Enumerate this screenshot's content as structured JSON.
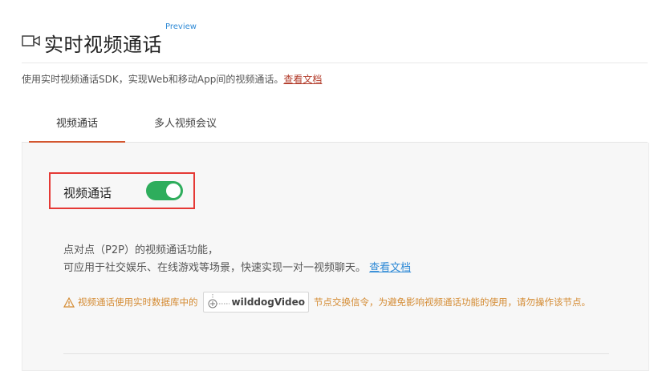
{
  "header": {
    "title": "实时视频通话",
    "badge": "Preview",
    "icon": "video-camera-icon"
  },
  "description": {
    "text": "使用实时视频通话SDK，实现Web和移动App间的视频通话。",
    "link": "查看文档"
  },
  "tabs": [
    {
      "label": "视频通话",
      "active": true
    },
    {
      "label": "多人视频会议",
      "active": false
    }
  ],
  "panel": {
    "toggle": {
      "label": "视频通话",
      "on": true
    },
    "feature_line1": "点对点（P2P）的视频通话功能，",
    "feature_line2": "可应用于社交娱乐、在线游戏等场景，快速实现一对一视频聊天。",
    "feature_link": "查看文档",
    "warning": {
      "before": "视频通话使用实时数据库中的",
      "node": "wilddogVideo",
      "after": "节点交换信令，为避免影响视频通话功能的使用，请勿操作该节点。"
    }
  },
  "colors": {
    "accent": "#d3562f",
    "toggle_on": "#2ead5c",
    "link_blue": "#2f8ad6",
    "warning": "#d48b33",
    "highlight_border": "#e53935"
  }
}
